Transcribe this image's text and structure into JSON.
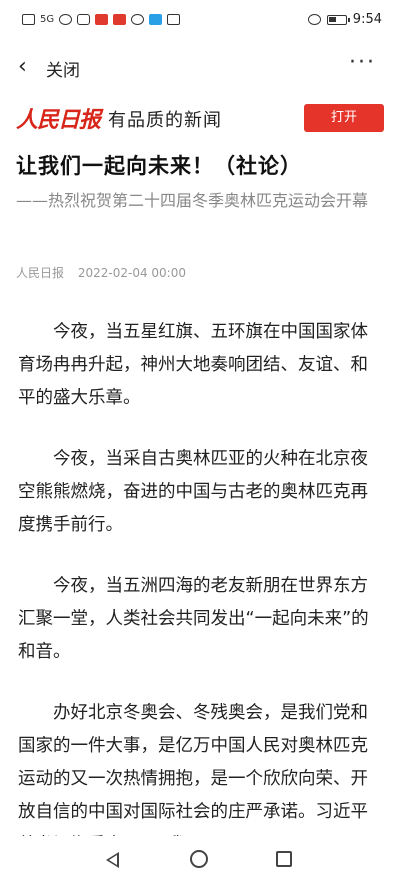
{
  "status": {
    "left_text": "5G",
    "time": "9:54",
    "battery_level": 0.45
  },
  "nav": {
    "close_label": "关闭",
    "more_label": "···"
  },
  "banner": {
    "logo": "人民日报",
    "slogan": "有品质的新闻",
    "open_button": "打开"
  },
  "article": {
    "title": "让我们一起向未来！（社论）",
    "subtitle": "——热烈祝贺第二十四届冬季奥林匹克运动会开幕",
    "source": "人民日报",
    "date": "2022-02-04 00:00",
    "paragraphs": [
      "今夜，当五星红旗、五环旗在中国国家体育场冉冉升起，神州大地奏响团结、友谊、和平的盛大乐章。",
      "今夜，当采自古奥林匹亚的火种在北京夜空熊熊燃烧，奋进的中国与古老的奥林匹克再度携手前行。",
      "今夜，当五洲四海的老友新朋在世界东方汇聚一堂，人类社会共同发出“一起向未来”的和音。",
      "办好北京冬奥会、冬残奥会，是我们党和国家的一件大事，是亿万中国人民对奥林匹克运动的又一次热情拥抱，是一个欣欣向荣、开放自信的中国对国际社会的庄严承诺。习近平总书记郑重宣示：“我"
    ]
  }
}
